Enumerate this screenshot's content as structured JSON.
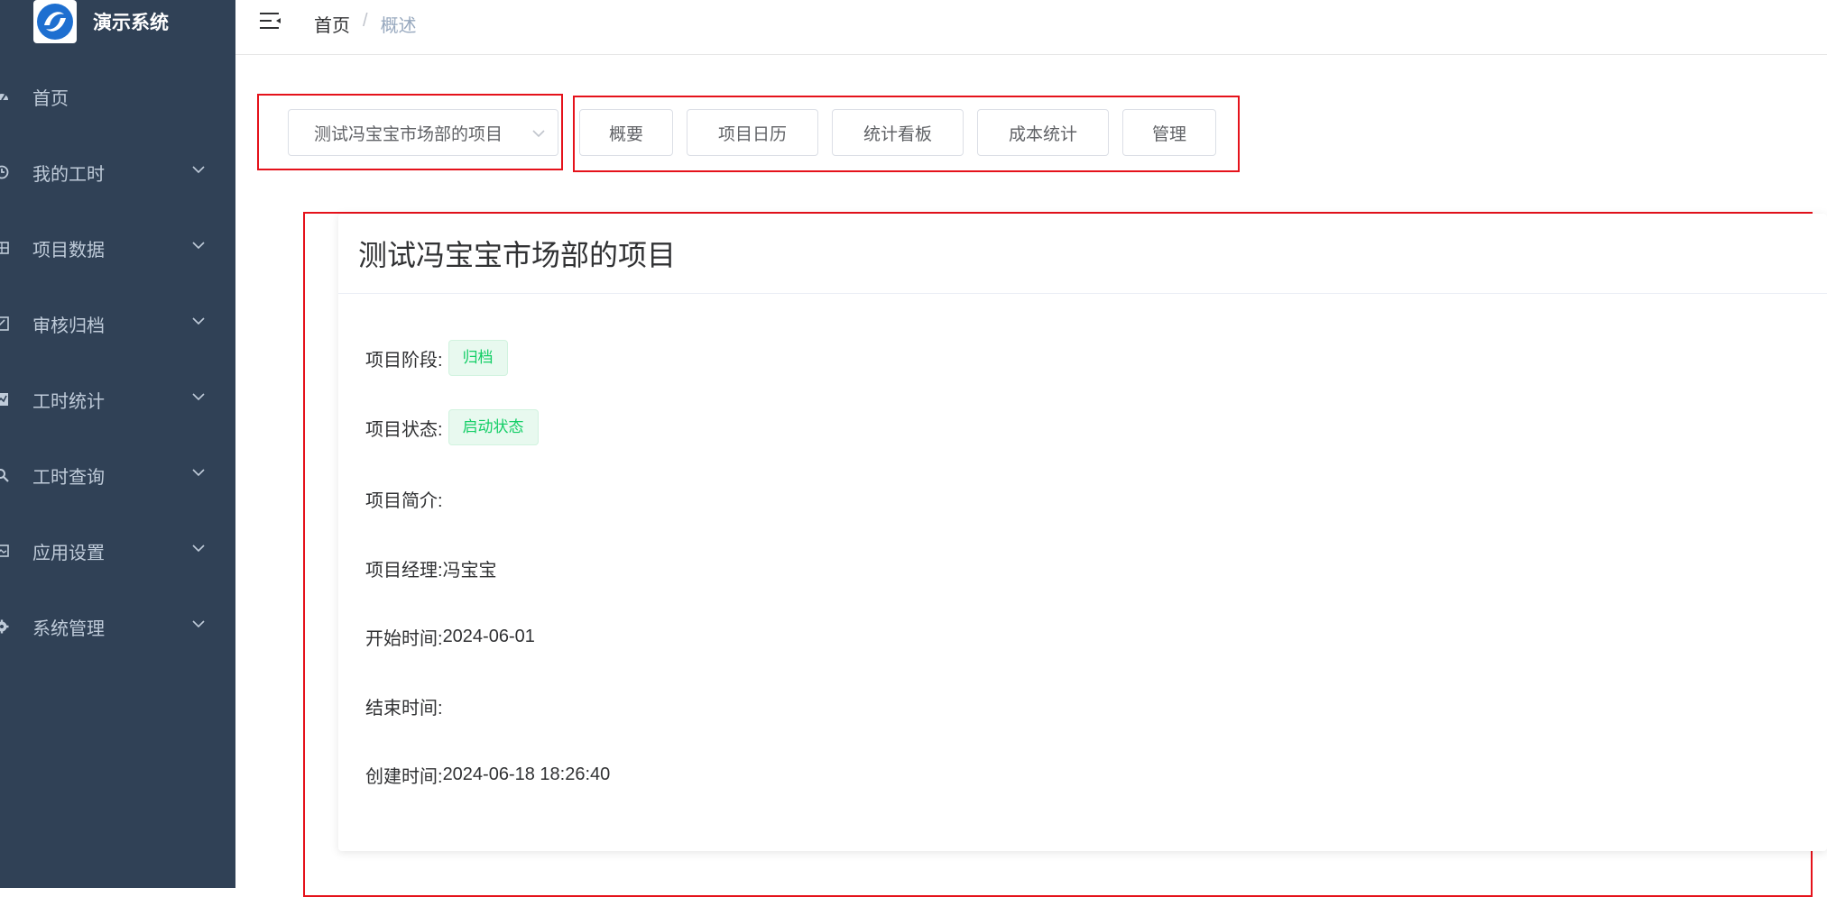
{
  "app": {
    "title": "演示系统"
  },
  "sidebar": {
    "items": [
      {
        "label": "首页",
        "icon": "dashboard-icon"
      },
      {
        "label": "我的工时",
        "icon": "clock-icon"
      },
      {
        "label": "项目数据",
        "icon": "table-icon"
      },
      {
        "label": "审核归档",
        "icon": "checkbox-icon"
      },
      {
        "label": "工时统计",
        "icon": "chart-icon"
      },
      {
        "label": "工时查询",
        "icon": "search-icon"
      },
      {
        "label": "应用设置",
        "icon": "image-icon"
      },
      {
        "label": "系统管理",
        "icon": "gear-icon"
      }
    ]
  },
  "header": {
    "breadcrumb": {
      "home": "首页",
      "separator": "/",
      "current": "概述"
    }
  },
  "toolbar": {
    "project_select": {
      "value": "测试冯宝宝市场部的项目"
    },
    "tabs": [
      "概要",
      "项目日历",
      "统计看板",
      "成本统计",
      "管理"
    ]
  },
  "project": {
    "title": "测试冯宝宝市场部的项目",
    "phase_label": "项目阶段:",
    "phase_value": "归档",
    "status_label": "项目状态:",
    "status_value": "启动状态",
    "summary_label": "项目简介:",
    "manager_label": "项目经理:",
    "manager_value": "冯宝宝",
    "start_label": "开始时间:",
    "start_value": "2024-06-01",
    "end_label": "结束时间:",
    "created_label": "创建时间:",
    "created_value": "2024-06-18 18:26:40"
  },
  "colors": {
    "sidebar_bg": "#304156",
    "highlight": "#e5121b",
    "tag_text": "#13ce66",
    "tag_bg": "#e8f9ef"
  }
}
